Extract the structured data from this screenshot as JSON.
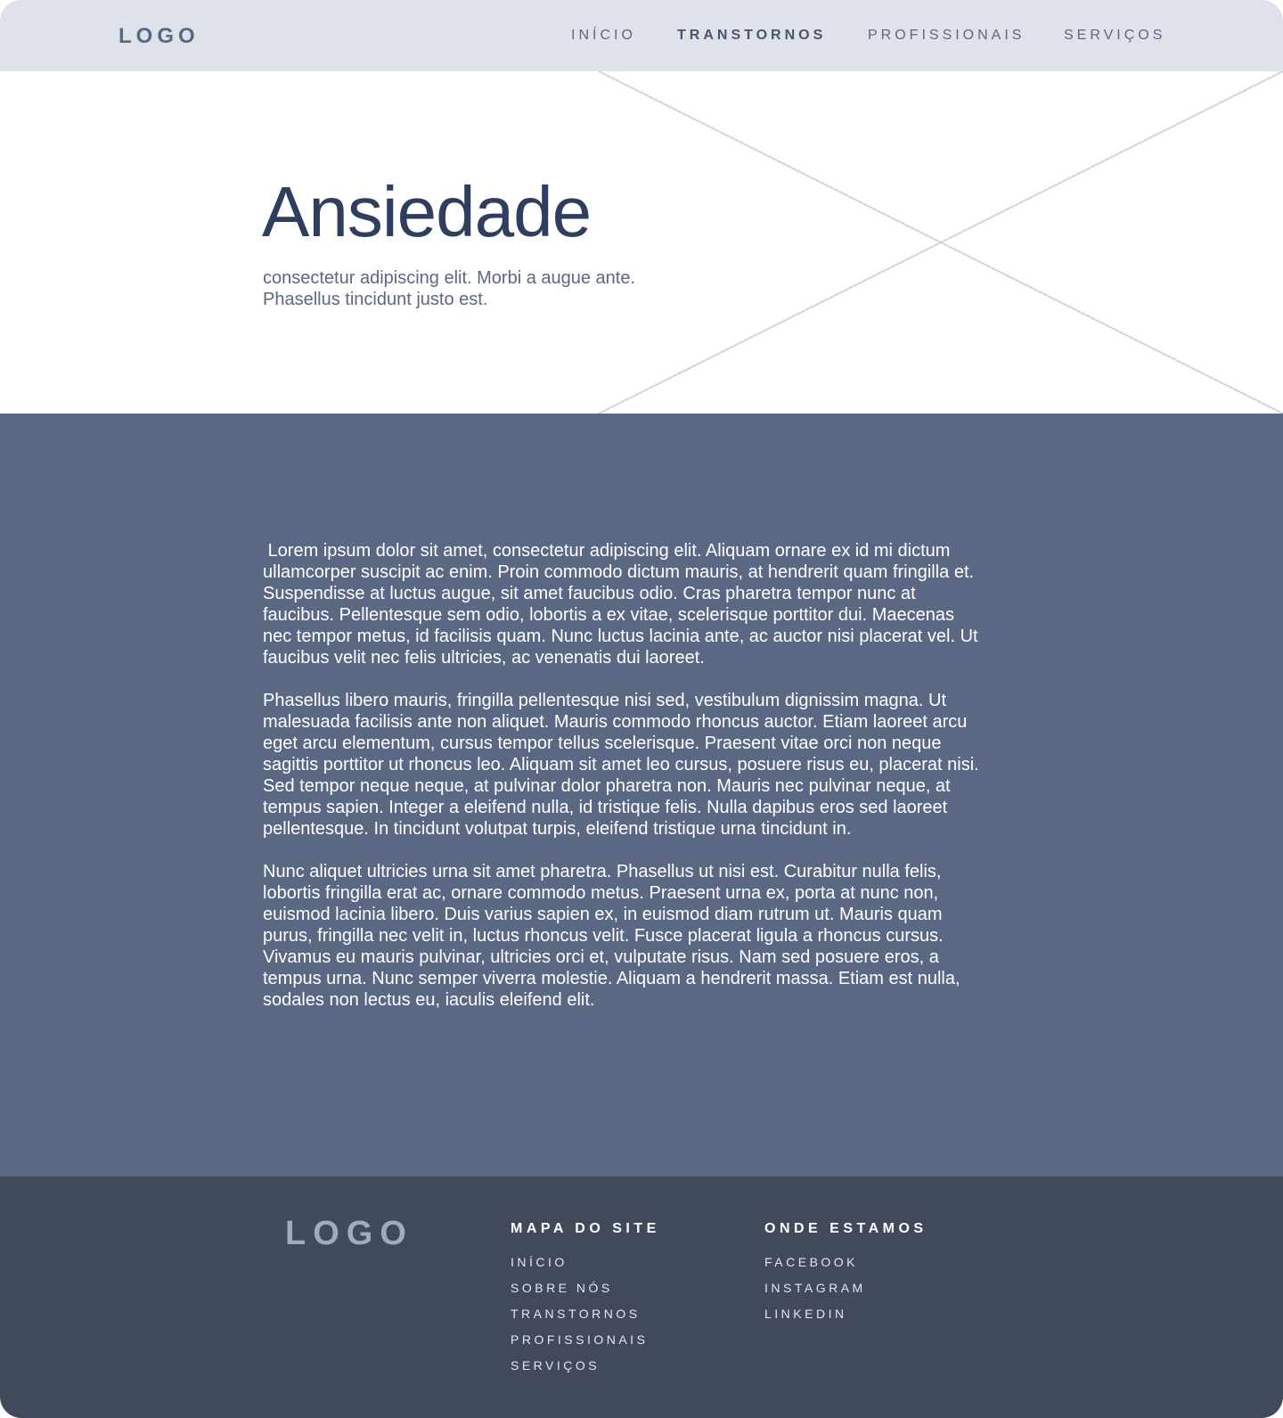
{
  "header": {
    "logo": "LOGO",
    "nav": [
      {
        "label": "INÍCIO"
      },
      {
        "label": "TRANSTORNOS"
      },
      {
        "label": "PROFISSIONAIS"
      },
      {
        "label": "SERVIÇOS"
      }
    ],
    "active_nav": "TRANSTORNOS"
  },
  "hero": {
    "title": "Ansiedade",
    "subtitle": "consectetur adipiscing elit. Morbi a augue ante. Phasellus tincidunt justo est.",
    "image": "image-placeholder"
  },
  "content": {
    "paragraphs": [
      " Lorem ipsum dolor sit amet, consectetur adipiscing elit. Aliquam ornare ex id mi dictum ullamcorper suscipit ac enim. Proin commodo dictum mauris, at hendrerit quam fringilla et. Suspendisse at luctus augue, sit amet faucibus odio. Cras pharetra tempor nunc at faucibus. Pellentesque sem odio, lobortis a ex vitae, scelerisque porttitor dui. Maecenas nec tempor metus, id facilisis quam. Nunc luctus lacinia ante, ac auctor nisi placerat vel. Ut faucibus velit nec felis ultricies, ac venenatis dui laoreet.",
      "Phasellus libero mauris, fringilla pellentesque nisi sed, vestibulum dignissim magna. Ut malesuada facilisis ante non aliquet. Mauris commodo rhoncus auctor. Etiam laoreet arcu eget arcu elementum, cursus tempor tellus scelerisque. Praesent vitae orci non neque sagittis porttitor ut rhoncus leo. Aliquam sit amet leo cursus, posuere risus eu, placerat nisi. Sed tempor neque neque, at pulvinar dolor pharetra non. Mauris nec pulvinar neque, at tempus sapien. Integer a eleifend nulla, id tristique felis. Nulla dapibus eros sed laoreet pellentesque. In tincidunt volutpat turpis, eleifend tristique urna tincidunt in.",
      "Nunc aliquet ultricies urna sit amet pharetra. Phasellus ut nisi est. Curabitur nulla felis, lobortis fringilla erat ac, ornare commodo metus. Praesent urna ex, porta at nunc non, euismod lacinia libero. Duis varius sapien ex, in euismod diam rutrum ut. Mauris quam purus, fringilla nec velit in, luctus rhoncus velit. Fusce placerat ligula a rhoncus cursus. Vivamus eu mauris pulvinar, ultricies orci et, vulputate risus. Nam sed posuere eros, a tempus urna. Nunc semper viverra molestie. Aliquam a hendrerit massa. Etiam est nulla, sodales non lectus eu, iaculis eleifend elit."
    ]
  },
  "footer": {
    "logo": "LOGO",
    "sitemap": {
      "heading": "MAPA DO SITE",
      "links": [
        "INÍCIO",
        "SOBRE NÓS",
        "TRANSTORNOS",
        "PROFISSIONAIS",
        "SERVIÇOS"
      ]
    },
    "location": {
      "heading": "ONDE ESTAMOS",
      "links": [
        "FACEBOOK",
        "INSTAGRAM",
        "LINKEDIN"
      ]
    }
  },
  "colors": {
    "header_bg": "#dfe2eb",
    "nav_text": "#5b6883",
    "title": "#2f3d5e",
    "content_bg": "#5a6883",
    "footer_bg": "#404a5b",
    "placeholder_lines": "#c3c8d6"
  }
}
